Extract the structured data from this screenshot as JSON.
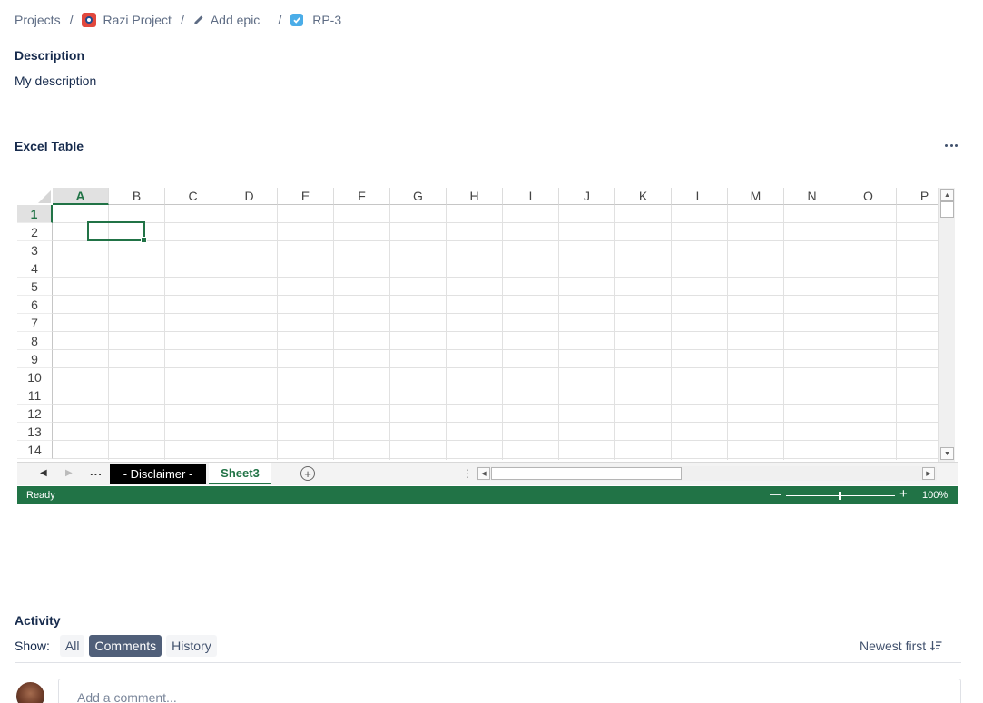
{
  "breadcrumb": {
    "projects": "Projects",
    "project": "Razi Project",
    "epic": "Add epic",
    "issue": "RP-3",
    "separator": "/"
  },
  "description": {
    "title": "Description",
    "text": "My description"
  },
  "excel": {
    "title": "Excel Table",
    "more_icon": "more-horizontal-icon",
    "columns": [
      "A",
      "B",
      "C",
      "D",
      "E",
      "F",
      "G",
      "H",
      "I",
      "J",
      "K",
      "L",
      "M",
      "N",
      "O",
      "P"
    ],
    "rows": [
      "1",
      "2",
      "3",
      "4",
      "5",
      "6",
      "7",
      "8",
      "9",
      "10",
      "11",
      "12",
      "13",
      "14"
    ],
    "active_column": "A",
    "active_row": "1",
    "tabs": {
      "more": "...",
      "disclaimer": "- Disclaimer -",
      "sheet3": "Sheet3",
      "add": "+"
    },
    "status": "Ready",
    "zoom_minus": "—",
    "zoom_plus": "+",
    "zoom_level": "100%",
    "zoom_fraction": 0.5,
    "accent_color": "#217346"
  },
  "activity": {
    "title": "Activity",
    "show_label": "Show:",
    "filters": [
      "All",
      "Comments",
      "History"
    ],
    "active_filter": "Comments",
    "sort_label": "Newest first",
    "comment_placeholder": "Add a comment..."
  }
}
